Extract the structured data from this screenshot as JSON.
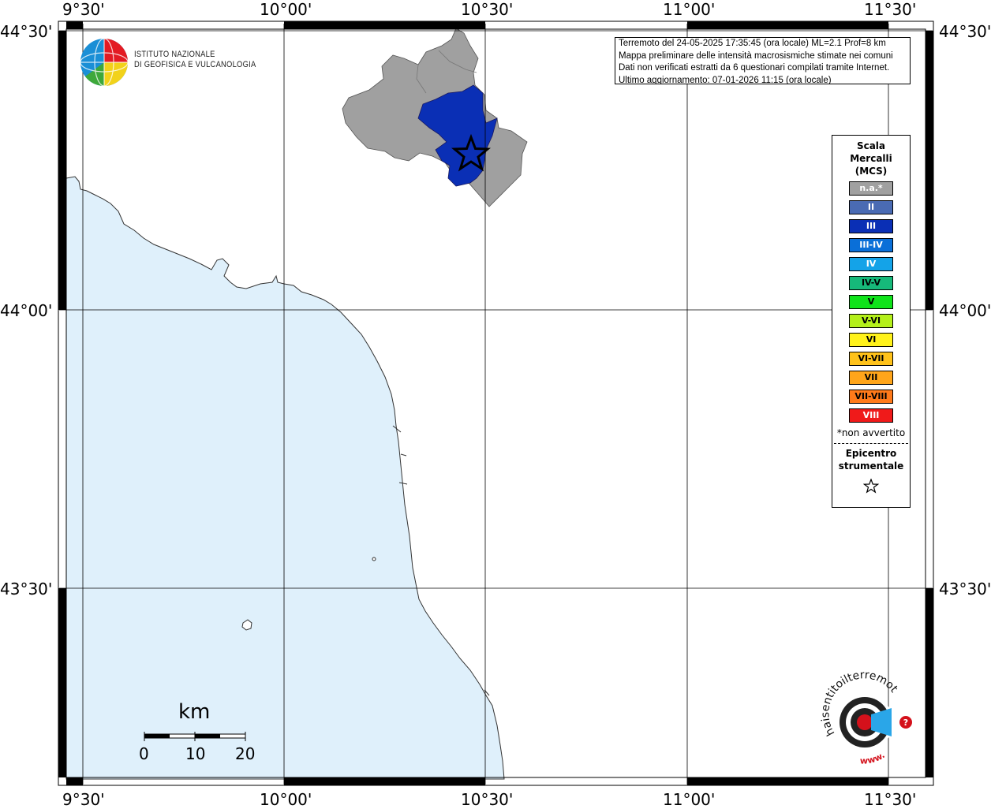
{
  "longitude_labels": [
    "9°30'",
    "10°00'",
    "10°30'",
    "11°00'",
    "11°30'"
  ],
  "latitude_labels": [
    "44°30'",
    "44°00'",
    "43°30'"
  ],
  "info": {
    "line1": "Terremoto del 24-05-2025 17:35:45 (ora locale) ML=2.1 Prof=8 km",
    "line2": "Mappa preliminare delle intensità macrosismiche stimate nei comuni",
    "line3": "Dati non verificati estratti da 6 questionari compilati tramite Internet.",
    "line4": "Ultimo aggiornamento: 07-01-2026 11:15 (ora locale)"
  },
  "logo": {
    "line1": "ISTITUTO NAZIONALE",
    "line2": "DI GEOFISICA E VULCANOLOGIA"
  },
  "legend": {
    "title_lines": [
      "Scala",
      "Mercalli",
      "(MCS)"
    ],
    "items": [
      {
        "label": "n.a.*",
        "color": "#a0a0a0",
        "text_color": "#ffffff"
      },
      {
        "label": "II",
        "color": "#4a6bb3",
        "text_color": "#ffffff"
      },
      {
        "label": "III",
        "color": "#0a2fb5",
        "text_color": "#ffffff"
      },
      {
        "label": "III-IV",
        "color": "#0a6fd8",
        "text_color": "#ffffff"
      },
      {
        "label": "IV",
        "color": "#14a3e8",
        "text_color": "#ffffff"
      },
      {
        "label": "IV-V",
        "color": "#16b97a",
        "text_color": "#000000"
      },
      {
        "label": "V",
        "color": "#0fe31a",
        "text_color": "#000000"
      },
      {
        "label": "V-VI",
        "color": "#b4f01a",
        "text_color": "#000000"
      },
      {
        "label": "VI",
        "color": "#fff21a",
        "text_color": "#000000"
      },
      {
        "label": "VI-VII",
        "color": "#ffc21a",
        "text_color": "#000000"
      },
      {
        "label": "VII",
        "color": "#ffa51a",
        "text_color": "#000000"
      },
      {
        "label": "VII-VIII",
        "color": "#ff7a1a",
        "text_color": "#000000"
      },
      {
        "label": "VIII",
        "color": "#f01a1a",
        "text_color": "#ffffff"
      }
    ],
    "note": "*non avvertito",
    "epicenter_lines": [
      "Epicentro",
      "strumentale"
    ],
    "epicenter_symbol": "☆"
  },
  "scale_bar": {
    "unit": "km",
    "ticks": [
      "0",
      "10",
      "20"
    ]
  },
  "colors": {
    "sea": "#dff0fb",
    "na_area": "#a0a0a0",
    "intensity_III": "#0a2fb5"
  },
  "watermark": {
    "text": "haisentitoilterremoto.it",
    "site": "www."
  }
}
